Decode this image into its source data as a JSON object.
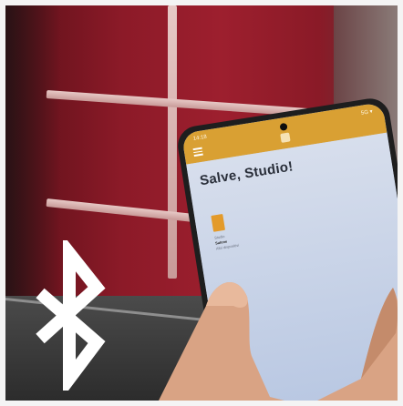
{
  "phone_app": {
    "greeting": "Salve, Studio!",
    "status_left": "14:18",
    "status_right": "5G ▾",
    "meta_lines": [
      "Studio",
      "Salone",
      "Altri dispositivi"
    ]
  },
  "colors": {
    "app_bar": "#d9a033",
    "accent_card": "#e39a2a",
    "wall": "#9d1f2e"
  },
  "icons": [
    "bluetooth-icon",
    "menu-icon",
    "bell-icon"
  ]
}
